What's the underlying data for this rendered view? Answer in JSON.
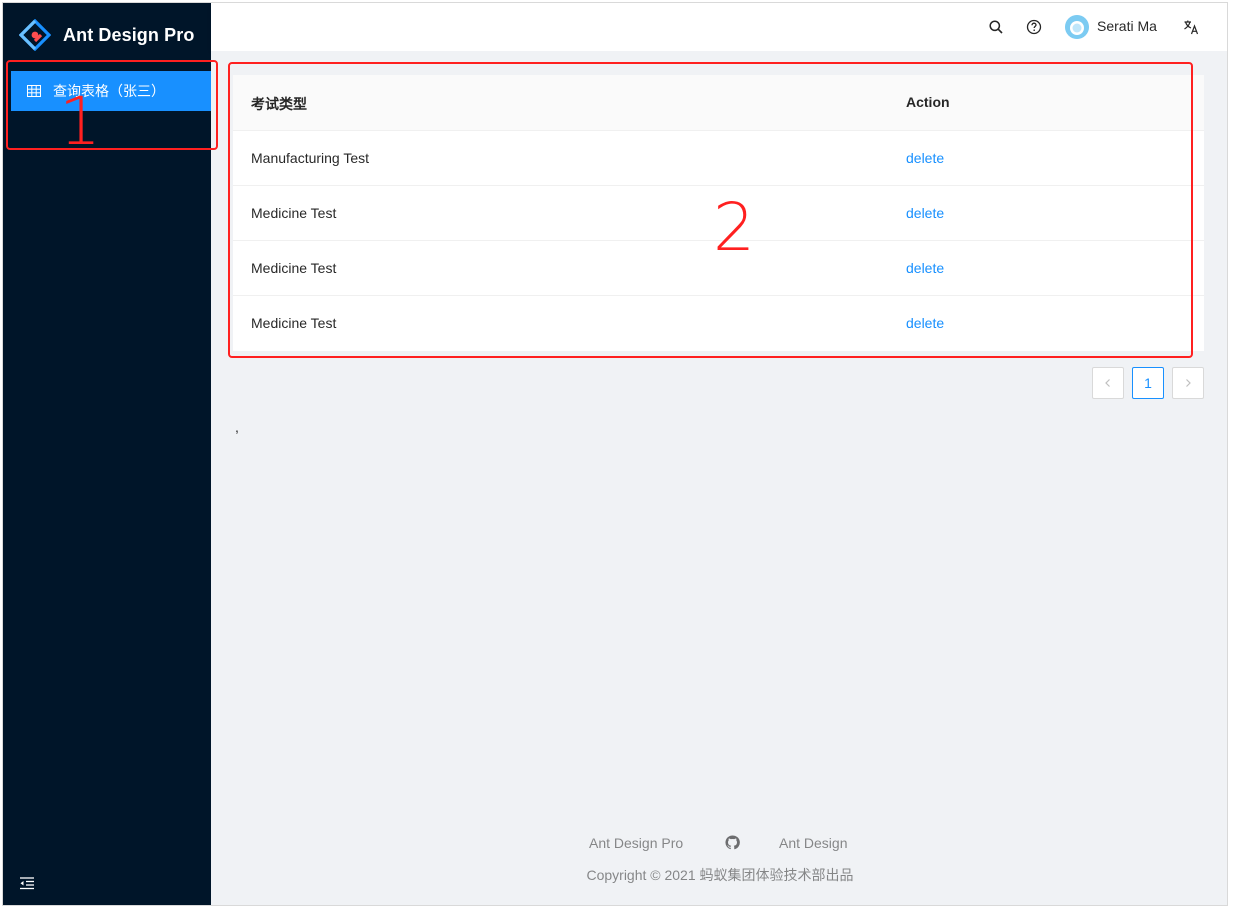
{
  "brand": {
    "title": "Ant Design Pro"
  },
  "sidebar": {
    "items": [
      {
        "label": "查询表格（张三）",
        "icon": "table-icon",
        "active": true
      }
    ],
    "collapse_icon": "menu-fold-icon"
  },
  "header": {
    "icons": [
      "search-icon",
      "question-circle-icon",
      "translation-icon"
    ],
    "user_name": "Serati Ma"
  },
  "table": {
    "columns": [
      "考试类型",
      "Action"
    ],
    "rows": [
      {
        "type": "Manufacturing Test",
        "action": "delete"
      },
      {
        "type": "Medicine Test",
        "action": "delete"
      },
      {
        "type": "Medicine Test",
        "action": "delete"
      },
      {
        "type": "Medicine Test",
        "action": "delete"
      }
    ]
  },
  "pagination": {
    "current": "1"
  },
  "stray_text": ",",
  "footer": {
    "links": [
      "Ant Design Pro",
      "Ant Design"
    ],
    "github_icon": "github-icon",
    "copyright": "Copyright © 2021 蚂蚁集团体验技术部出品"
  },
  "annotations": [
    "1",
    "2"
  ],
  "colors": {
    "primary": "#1890ff",
    "sider_bg": "#001529",
    "content_bg": "#f0f2f5",
    "annotation": "#ff2020"
  }
}
